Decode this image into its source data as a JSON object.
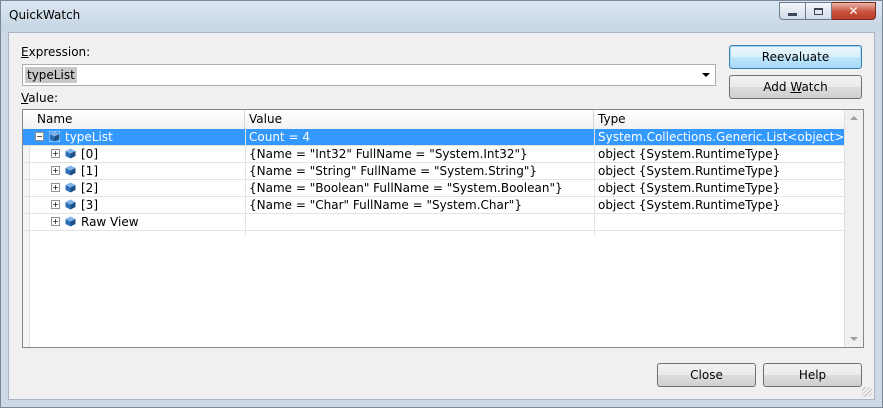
{
  "window": {
    "title": "QuickWatch"
  },
  "expression": {
    "label_pre": "",
    "label_accel": "E",
    "label_post": "xpression:",
    "value": "typeList"
  },
  "value_section": {
    "label_accel": "V",
    "label_post": "alue:"
  },
  "buttons": {
    "reevaluate": "Reevaluate",
    "add_watch_pre": "Add ",
    "add_watch_accel": "W",
    "add_watch_post": "atch",
    "close": "Close",
    "help": "Help"
  },
  "grid": {
    "columns": [
      "Name",
      "Value",
      "Type"
    ],
    "rows": [
      {
        "name": "typeList",
        "value": "Count = 4",
        "type": "System.Collections.Generic.List<object>",
        "expander": "−",
        "selected": true,
        "level": 0
      },
      {
        "name": "[0]",
        "value": "{Name = \"Int32\" FullName = \"System.Int32\"}",
        "type": "object {System.RuntimeType}",
        "expander": "+",
        "selected": false,
        "level": 1
      },
      {
        "name": "[1]",
        "value": "{Name = \"String\" FullName = \"System.String\"}",
        "type": "object {System.RuntimeType}",
        "expander": "+",
        "selected": false,
        "level": 1
      },
      {
        "name": "[2]",
        "value": "{Name = \"Boolean\" FullName = \"System.Boolean\"}",
        "type": "object {System.RuntimeType}",
        "expander": "+",
        "selected": false,
        "level": 1
      },
      {
        "name": "[3]",
        "value": "{Name = \"Char\" FullName = \"System.Char\"}",
        "type": "object {System.RuntimeType}",
        "expander": "+",
        "selected": false,
        "level": 1
      },
      {
        "name": "Raw View",
        "value": "",
        "type": "",
        "expander": "+",
        "selected": false,
        "level": 1
      }
    ]
  },
  "colors": {
    "selection": "#3399ff",
    "object_icon": "#2a6fb8"
  },
  "icons": {
    "row_icon": "object-cube-icon"
  }
}
